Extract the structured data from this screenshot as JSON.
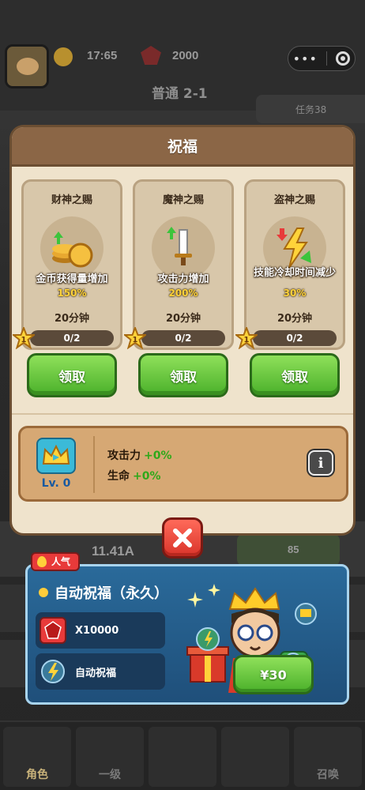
{
  "hud": {
    "gold": "17:65",
    "gems": "2000",
    "stage": "普通 2-1",
    "task": "任务38",
    "power": "11.41A",
    "cost": "85",
    "capsule_more": "•••"
  },
  "modal": {
    "title": "祝福",
    "cards": [
      {
        "name": "财神之赐",
        "effect": "金币获得量增加",
        "value": "150%",
        "duration": "20分钟",
        "progress": "0/2",
        "star_level": "1",
        "button": "领取"
      },
      {
        "name": "魔神之赐",
        "effect": "攻击力增加",
        "value": "200%",
        "duration": "20分钟",
        "progress": "0/2",
        "star_level": "1",
        "button": "领取"
      },
      {
        "name": "盗神之赐",
        "effect": "技能冷却时间减少",
        "value": "30%",
        "duration": "20分钟",
        "progress": "0/2",
        "star_level": "1",
        "button": "领取"
      }
    ],
    "summary": {
      "level": "Lv. 0",
      "attack_label": "攻击力",
      "attack_value": "+0%",
      "hp_label": "生命",
      "hp_value": "+0%",
      "info": "i"
    }
  },
  "promo": {
    "tag": "人气",
    "title": "自动祝福（永久）",
    "reward_gems": "X10000",
    "reward_auto": "自动祝福",
    "price": "¥30"
  },
  "nav": {
    "items": [
      "角色",
      "一级",
      "",
      "",
      "召唤"
    ]
  },
  "colors": {
    "modal_bg": "#efe3cc",
    "modal_header": "#8b6646",
    "button_green": "#4ab02a",
    "close_red": "#d9342a",
    "value_yellow": "#ffd33a",
    "promo_blue": "#1f4f7a"
  }
}
